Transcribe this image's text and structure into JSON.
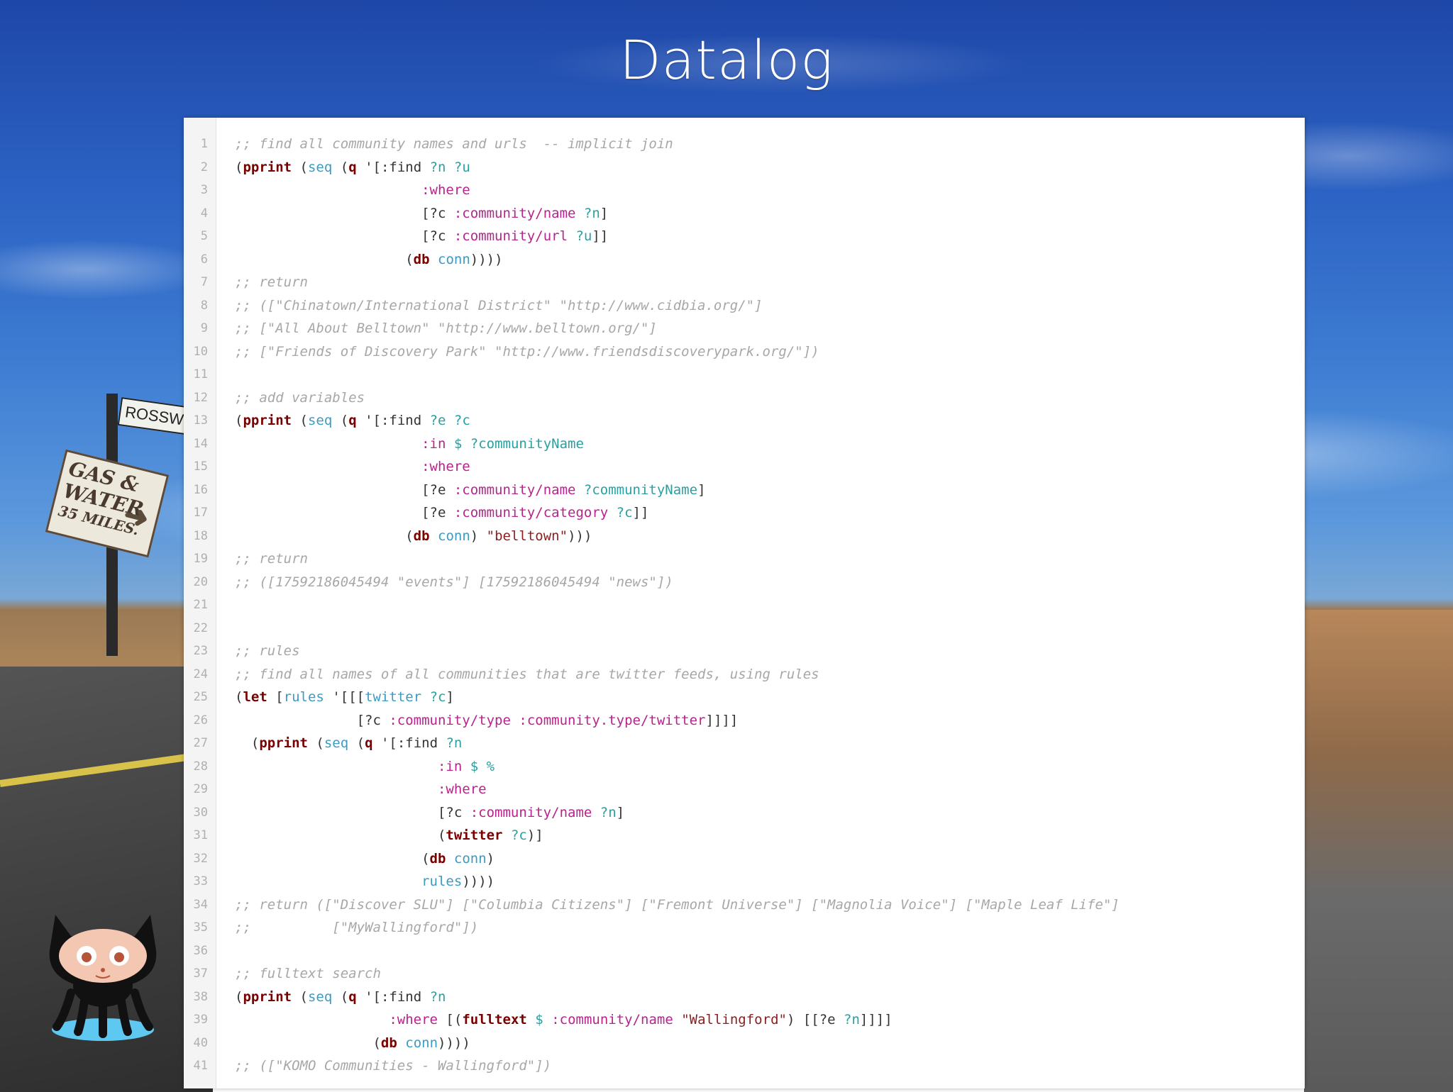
{
  "slide": {
    "title": "Datalog"
  },
  "scenery": {
    "street_sign": "ROSSWEL",
    "gas_sign": [
      "GAS &",
      "WATER",
      "35 MILES."
    ]
  },
  "code": {
    "lines": [
      [
        [
          "c",
          ";; find all community names and urls  -- implicit join"
        ]
      ],
      [
        [
          "p",
          "("
        ],
        [
          "k",
          "pprint"
        ],
        [
          "p",
          " ("
        ],
        [
          "fn",
          "seq"
        ],
        [
          "p",
          " ("
        ],
        [
          "k",
          "q"
        ],
        [
          "p",
          " '[:find "
        ],
        [
          "v",
          "?n ?u"
        ]
      ],
      [
        [
          "p",
          "                       "
        ],
        [
          "kw",
          ":where"
        ]
      ],
      [
        [
          "p",
          "                       [?c "
        ],
        [
          "kw",
          ":community/name"
        ],
        [
          "p",
          " "
        ],
        [
          "v",
          "?n"
        ],
        [
          "p",
          "]"
        ]
      ],
      [
        [
          "p",
          "                       [?c "
        ],
        [
          "kw",
          ":community/url"
        ],
        [
          "p",
          " "
        ],
        [
          "v",
          "?u"
        ],
        [
          "p",
          "]]"
        ]
      ],
      [
        [
          "p",
          "                     ("
        ],
        [
          "k",
          "db"
        ],
        [
          "p",
          " "
        ],
        [
          "fn",
          "conn"
        ],
        [
          "p",
          "))))"
        ]
      ],
      [
        [
          "c",
          ";; return"
        ]
      ],
      [
        [
          "c",
          ";; ([\"Chinatown/International District\" \"http://www.cidbia.org/\"]"
        ]
      ],
      [
        [
          "c",
          ";; [\"All About Belltown\" \"http://www.belltown.org/\"]"
        ]
      ],
      [
        [
          "c",
          ";; [\"Friends of Discovery Park\" \"http://www.friendsdiscoverypark.org/\"])"
        ]
      ],
      [
        [
          "p",
          ""
        ]
      ],
      [
        [
          "c",
          ";; add variables"
        ]
      ],
      [
        [
          "p",
          "("
        ],
        [
          "k",
          "pprint"
        ],
        [
          "p",
          " ("
        ],
        [
          "fn",
          "seq"
        ],
        [
          "p",
          " ("
        ],
        [
          "k",
          "q"
        ],
        [
          "p",
          " '[:find "
        ],
        [
          "v",
          "?e ?c"
        ]
      ],
      [
        [
          "p",
          "                       "
        ],
        [
          "kw",
          ":in"
        ],
        [
          "p",
          " "
        ],
        [
          "v",
          "$ ?communityName"
        ]
      ],
      [
        [
          "p",
          "                       "
        ],
        [
          "kw",
          ":where"
        ]
      ],
      [
        [
          "p",
          "                       [?e "
        ],
        [
          "kw",
          ":community/name"
        ],
        [
          "p",
          " "
        ],
        [
          "v",
          "?communityName"
        ],
        [
          "p",
          "]"
        ]
      ],
      [
        [
          "p",
          "                       [?e "
        ],
        [
          "kw",
          ":community/category"
        ],
        [
          "p",
          " "
        ],
        [
          "v",
          "?c"
        ],
        [
          "p",
          "]]"
        ]
      ],
      [
        [
          "p",
          "                     ("
        ],
        [
          "k",
          "db"
        ],
        [
          "p",
          " "
        ],
        [
          "fn",
          "conn"
        ],
        [
          "p",
          ") "
        ],
        [
          "s",
          "\"belltown\""
        ],
        [
          "p",
          ")))"
        ]
      ],
      [
        [
          "c",
          ";; return"
        ]
      ],
      [
        [
          "c",
          ";; ([17592186045494 \"events\"] [17592186045494 \"news\"])"
        ]
      ],
      [
        [
          "p",
          ""
        ]
      ],
      [
        [
          "p",
          ""
        ]
      ],
      [
        [
          "c",
          ";; rules"
        ]
      ],
      [
        [
          "c",
          ";; find all names of all communities that are twitter feeds, using rules"
        ]
      ],
      [
        [
          "p",
          "("
        ],
        [
          "k",
          "let"
        ],
        [
          "p",
          " ["
        ],
        [
          "fn",
          "rules"
        ],
        [
          "p",
          " '[[["
        ],
        [
          "fn",
          "twitter"
        ],
        [
          "p",
          " "
        ],
        [
          "v",
          "?c"
        ],
        [
          "p",
          "]"
        ]
      ],
      [
        [
          "p",
          "               [?c "
        ],
        [
          "kw",
          ":community/type"
        ],
        [
          "p",
          " "
        ],
        [
          "kw",
          ":community.type/twitter"
        ],
        [
          "p",
          "]]]]"
        ]
      ],
      [
        [
          "p",
          "  ("
        ],
        [
          "k",
          "pprint"
        ],
        [
          "p",
          " ("
        ],
        [
          "fn",
          "seq"
        ],
        [
          "p",
          " ("
        ],
        [
          "k",
          "q"
        ],
        [
          "p",
          " '[:find "
        ],
        [
          "v",
          "?n"
        ]
      ],
      [
        [
          "p",
          "                         "
        ],
        [
          "kw",
          ":in"
        ],
        [
          "p",
          " "
        ],
        [
          "v",
          "$ %"
        ]
      ],
      [
        [
          "p",
          "                         "
        ],
        [
          "kw",
          ":where"
        ]
      ],
      [
        [
          "p",
          "                         [?c "
        ],
        [
          "kw",
          ":community/name"
        ],
        [
          "p",
          " "
        ],
        [
          "v",
          "?n"
        ],
        [
          "p",
          "]"
        ]
      ],
      [
        [
          "p",
          "                         ("
        ],
        [
          "k",
          "twitter"
        ],
        [
          "p",
          " "
        ],
        [
          "v",
          "?c"
        ],
        [
          "p",
          ")]"
        ]
      ],
      [
        [
          "p",
          "                       ("
        ],
        [
          "k",
          "db"
        ],
        [
          "p",
          " "
        ],
        [
          "fn",
          "conn"
        ],
        [
          "p",
          ")"
        ]
      ],
      [
        [
          "p",
          "                       "
        ],
        [
          "fn",
          "rules"
        ],
        [
          "p",
          "))))"
        ]
      ],
      [
        [
          "c",
          ";; return ([\"Discover SLU\"] [\"Columbia Citizens\"] [\"Fremont Universe\"] [\"Magnolia Voice\"] [\"Maple Leaf Life\"]"
        ]
      ],
      [
        [
          "c",
          ";;          [\"MyWallingford\"])"
        ]
      ],
      [
        [
          "p",
          ""
        ]
      ],
      [
        [
          "c",
          ";; fulltext search"
        ]
      ],
      [
        [
          "p",
          "("
        ],
        [
          "k",
          "pprint"
        ],
        [
          "p",
          " ("
        ],
        [
          "fn",
          "seq"
        ],
        [
          "p",
          " ("
        ],
        [
          "k",
          "q"
        ],
        [
          "p",
          " '[:find "
        ],
        [
          "v",
          "?n"
        ]
      ],
      [
        [
          "p",
          "                   "
        ],
        [
          "kw",
          ":where"
        ],
        [
          "p",
          " [("
        ],
        [
          "k",
          "fulltext"
        ],
        [
          "p",
          " "
        ],
        [
          "v",
          "$"
        ],
        [
          "p",
          " "
        ],
        [
          "kw",
          ":community/name"
        ],
        [
          "p",
          " "
        ],
        [
          "s",
          "\"Wallingford\""
        ],
        [
          "p",
          ") [[?e "
        ],
        [
          "v",
          "?n"
        ],
        [
          "p",
          "]]]]"
        ]
      ],
      [
        [
          "p",
          "                 ("
        ],
        [
          "k",
          "db"
        ],
        [
          "p",
          " "
        ],
        [
          "fn",
          "conn"
        ],
        [
          "p",
          "))))"
        ]
      ],
      [
        [
          "c",
          ";; ([\"KOMO Communities - Wallingford\"])"
        ]
      ]
    ]
  },
  "colors": {
    "comment": "#a7a7a7",
    "core_fn": "#7a0000",
    "fn": "#3c9ac3",
    "keyword": "#b8238c",
    "variable": "#2aa0a0",
    "string": "#8a1f1f"
  },
  "icons": {
    "mascot": "octocat-icon"
  }
}
